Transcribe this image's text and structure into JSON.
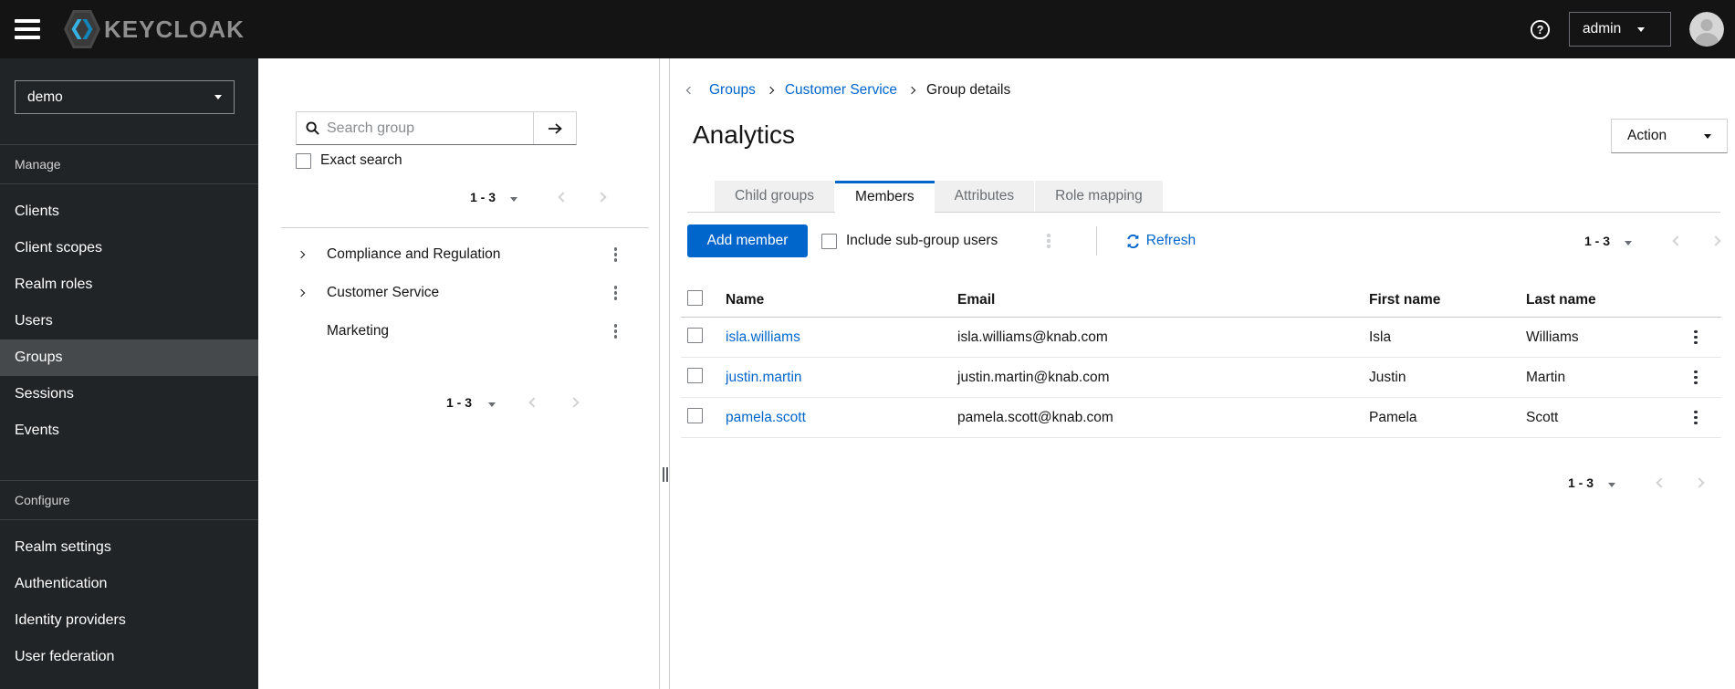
{
  "colors": {
    "primary": "#0066cc",
    "link": "#0066cc",
    "masthead_bg": "#141414",
    "sidebar_bg": "#212427",
    "nav_selected_bg": "#46494c",
    "tab_inactive_bg": "#f0f0f0",
    "muted_text": "#6a6e73",
    "logo_blue": "#35b1e4"
  },
  "topbar": {
    "brand_text": "KEYCLOAK",
    "help_glyph": "?",
    "user_menu_label": "admin"
  },
  "sidebar": {
    "realm": "demo",
    "sections": [
      {
        "title": "Manage",
        "items": [
          {
            "label": "Clients",
            "selected": false
          },
          {
            "label": "Client scopes",
            "selected": false
          },
          {
            "label": "Realm roles",
            "selected": false
          },
          {
            "label": "Users",
            "selected": false
          },
          {
            "label": "Groups",
            "selected": true
          },
          {
            "label": "Sessions",
            "selected": false
          },
          {
            "label": "Events",
            "selected": false
          }
        ]
      },
      {
        "title": "Configure",
        "items": [
          {
            "label": "Realm settings",
            "selected": false
          },
          {
            "label": "Authentication",
            "selected": false
          },
          {
            "label": "Identity providers",
            "selected": false
          },
          {
            "label": "User federation",
            "selected": false
          }
        ]
      }
    ]
  },
  "groups_panel": {
    "search_placeholder": "Search group",
    "exact_search_label": "Exact search",
    "pagination_top": {
      "range": "1 - 3"
    },
    "tree": [
      {
        "label": "Compliance and Regulation",
        "expandable": true
      },
      {
        "label": "Customer Service",
        "expandable": true
      },
      {
        "label": "Marketing",
        "expandable": false
      }
    ],
    "pagination_bottom": {
      "range": "1 - 3"
    }
  },
  "main": {
    "breadcrumb": {
      "items": [
        {
          "label": "Groups",
          "link": true
        },
        {
          "label": "Customer Service",
          "link": true
        },
        {
          "label": "Group details",
          "link": false
        }
      ]
    },
    "title": "Analytics",
    "action_button_label": "Action",
    "tabs": [
      {
        "label": "Child groups",
        "active": false
      },
      {
        "label": "Members",
        "active": true
      },
      {
        "label": "Attributes",
        "active": false
      },
      {
        "label": "Role mapping",
        "active": false
      }
    ],
    "toolbar": {
      "add_member_label": "Add member",
      "include_subgroups_label": "Include sub-group users",
      "refresh_label": "Refresh",
      "pagination": {
        "range": "1 - 3"
      }
    },
    "table": {
      "headers": {
        "name": "Name",
        "email": "Email",
        "first_name": "First name",
        "last_name": "Last name"
      },
      "rows": [
        {
          "username": "isla.williams",
          "email": "isla.williams@knab.com",
          "first_name": "Isla",
          "last_name": "Williams"
        },
        {
          "username": "justin.martin",
          "email": "justin.martin@knab.com",
          "first_name": "Justin",
          "last_name": "Martin"
        },
        {
          "username": "pamela.scott",
          "email": "pamela.scott@knab.com",
          "first_name": "Pamela",
          "last_name": "Scott"
        }
      ]
    },
    "pagination_bottom": {
      "range": "1 - 3"
    }
  }
}
